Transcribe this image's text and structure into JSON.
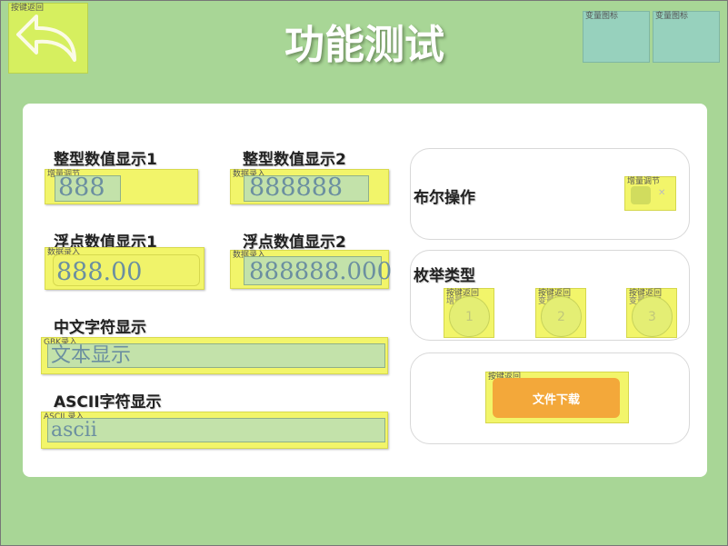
{
  "header": {
    "title": "功能测试",
    "back_button_tag": "按键返回",
    "icon_tags": [
      "变量图标",
      "变量图标"
    ]
  },
  "fields": {
    "int1": {
      "label": "整型数值显示1",
      "tag": "增量调节",
      "value": "888"
    },
    "int2": {
      "label": "整型数值显示2",
      "tag": "数据录入",
      "value": "888888"
    },
    "float1": {
      "label": "浮点数值显示1",
      "tag": "数据录入",
      "value": "888.00"
    },
    "float2": {
      "label": "浮点数值显示2",
      "tag": "数据录入",
      "value": "888888.000"
    },
    "chinese": {
      "label": "中文字符显示",
      "tag": "GBK录入",
      "value": "文本显示"
    },
    "ascii": {
      "label": "ASCII字符显示",
      "tag": "ASCII 录入",
      "value": "ascii"
    }
  },
  "bool": {
    "label": "布尔操作",
    "tag": "增量调节"
  },
  "enum": {
    "label": "枚举类型",
    "buttons": [
      {
        "tag": "按键返回",
        "sub": "增量调",
        "value": "1"
      },
      {
        "tag": "按键返回",
        "sub": "变量图标",
        "value": "2"
      },
      {
        "tag": "按键返回",
        "sub": "变量图标",
        "value": "3"
      }
    ]
  },
  "download": {
    "tag": "按键返回",
    "label": "文件下载"
  },
  "colors": {
    "background": "#a8d696",
    "field": "#f2f56a",
    "download": "#f3a83a",
    "icon": "#97d1bd"
  }
}
